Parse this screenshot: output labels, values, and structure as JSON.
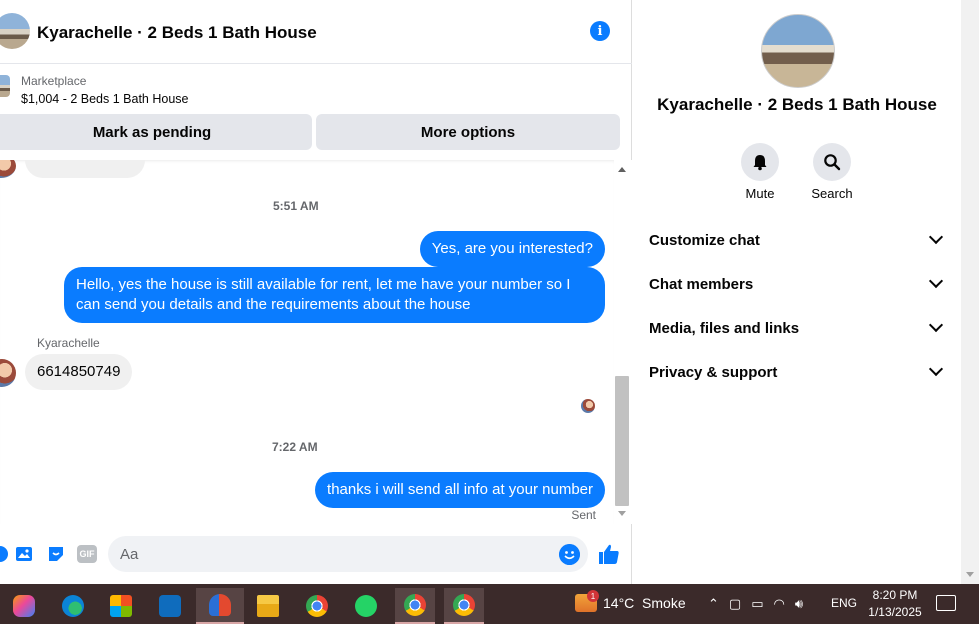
{
  "header": {
    "title": "Kyarachelle · 2 Beds 1 Bath House"
  },
  "listing": {
    "source": "Marketplace",
    "price_title": "$1,004 - 2 Beds 1 Bath House",
    "mark_pending_label": "Mark as pending",
    "more_options_label": "More options"
  },
  "messages": [
    {
      "type": "timestamp",
      "text": "5:51 AM"
    },
    {
      "type": "outgoing",
      "text": "Yes, are you interested?"
    },
    {
      "type": "outgoing",
      "text": "Hello, yes the house is still available for rent, let me have your number so I can send you details and the requirements about the house"
    },
    {
      "type": "sender",
      "text": "Kyarachelle"
    },
    {
      "type": "incoming",
      "text": "6614850749"
    },
    {
      "type": "timestamp",
      "text": "7:22 AM"
    },
    {
      "type": "outgoing",
      "text": "thanks i will send all info at your number"
    },
    {
      "type": "status",
      "text": "Sent"
    }
  ],
  "composer": {
    "placeholder": "Aa",
    "gif_label": "GIF"
  },
  "info_pane": {
    "title": "Kyarachelle · 2 Beds 1 Bath House",
    "mute_label": "Mute",
    "search_label": "Search",
    "sections": [
      "Customize chat",
      "Chat members",
      "Media, files and links",
      "Privacy & support"
    ]
  },
  "taskbar": {
    "weather_badge": "1",
    "weather": "14°C  Smoke",
    "language": "ENG",
    "time": "8:20 PM",
    "date": "1/13/2025"
  },
  "colors": {
    "messenger_blue": "#0a7cff",
    "bubble_gray": "#f0f0f0",
    "taskbar_bg": "#3b2a2a"
  }
}
